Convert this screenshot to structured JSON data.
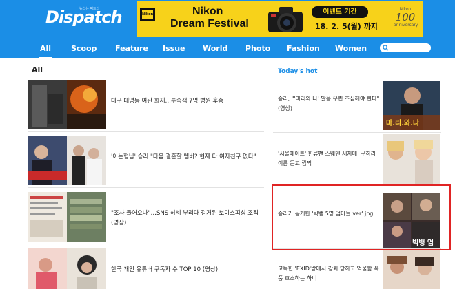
{
  "header": {
    "logo_text": "Dispatch",
    "logo_tagline": "뉴스는 팩트다",
    "banner": {
      "brand": "Nikon",
      "title": "Dream Festival",
      "badge_text": "Nikon",
      "event_label": "이벤트 기간",
      "event_date": "18. 2. 5(월) 까지",
      "anniversary_brand": "Nikon",
      "anniversary_number": "100",
      "anniversary_sub": "anniversary"
    },
    "nav": [
      "All",
      "Scoop",
      "Feature",
      "Issue",
      "World",
      "Photo",
      "Fashion",
      "Women"
    ],
    "active_nav": "All",
    "search_placeholder": ""
  },
  "main": {
    "section_title": "All",
    "articles": [
      {
        "title": "대구 대명동 여관 화재…투숙객 7명 병원 후송"
      },
      {
        "title": "'아는형님' 승리 \"다음 결혼할 멤버? 현재 다 여자친구 없다\""
      },
      {
        "title": "\"조사 들어오나\"…SNS 허세 부리다 걸거된 보이스피싱 조직 (영상)"
      },
      {
        "title": "한국 개인 유튜버 구독자 수 TOP 10 (영상)"
      }
    ]
  },
  "sidebar": {
    "title": "Today's hot",
    "items": [
      {
        "title": "승리, \"'마리와 나' 발음 우린 조심해야 한다\"(영상)",
        "thumb_caption": "마.리.와.나"
      },
      {
        "title": "'서울메이트' 한류팬 스웨덴 세자매, 구하라 이름 듣고 깜짝",
        "thumb_caption": ""
      },
      {
        "title": "승리가 공개한 '빅뱅 5명 엄마들 ver'.jpg",
        "thumb_caption": "빅뱅 엄"
      },
      {
        "title": "고독한 'EXID'방에서 강퇴 당하고 억울함 폭풍 호소하는 하니",
        "thumb_caption": ""
      }
    ]
  },
  "colors": {
    "header_bg": "#1b8ee6",
    "banner_bg": "#f7d21a",
    "accent_blue": "#1b8ee6",
    "highlight_red": "#e02424"
  }
}
